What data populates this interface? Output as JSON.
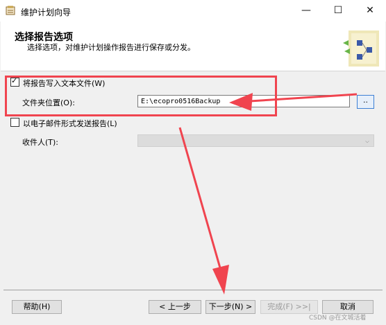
{
  "window": {
    "title": "维护计划向导",
    "minimize": "—",
    "maximize": "☐",
    "close": "✕"
  },
  "header": {
    "title": "选择报告选项",
    "subtitle": "选择选项，对维护计划操作报告进行保存或分发。"
  },
  "options": {
    "write_to_file": {
      "label": "将报告写入文本文件(W)",
      "checked": true,
      "check_mark": "✓"
    },
    "folder": {
      "label": "文件夹位置(O):",
      "value": "E:\\ecopro0516Backup",
      "browse_label": ".."
    },
    "email": {
      "label": "以电子邮件形式发送报告(L)",
      "checked": false
    },
    "recipient": {
      "label": "收件人(T):",
      "value": "",
      "arrow": "⌵"
    }
  },
  "buttons": {
    "help": "帮助(H)",
    "back": "< 上一步",
    "next": "下一步(N) >",
    "finish": "完成(F) >>|",
    "cancel": "取消"
  },
  "watermark": "CSDN @在文城活着",
  "colors": {
    "annotation": "#f0444f",
    "accent": "#3c7fd4"
  }
}
